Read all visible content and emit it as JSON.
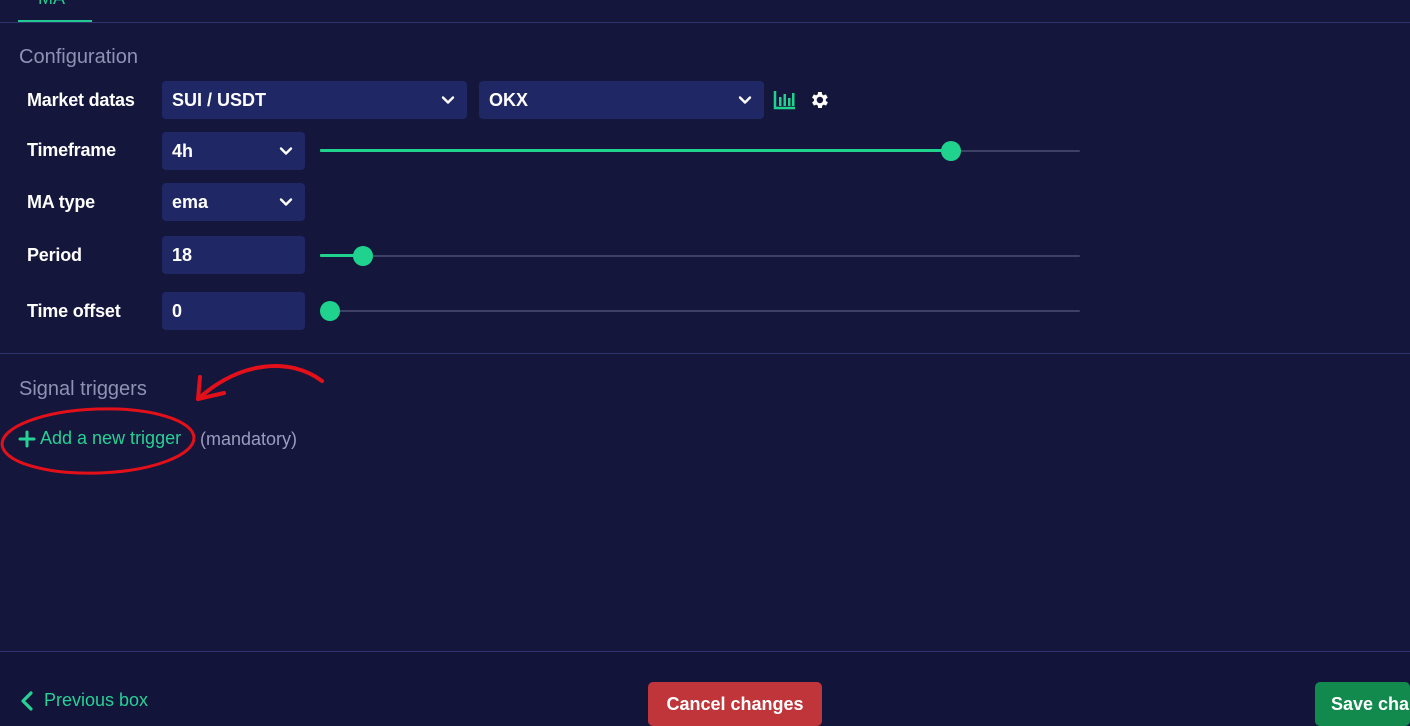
{
  "tab": {
    "label": "MA"
  },
  "configuration": {
    "title": "Configuration",
    "market": {
      "label": "Market datas",
      "pair": "SUI / USDT",
      "exchange": "OKX",
      "chart_icon": "chart-bars-icon",
      "settings_icon": "gear-icon"
    },
    "timeframe": {
      "label": "Timeframe",
      "value": "4h",
      "slider_fraction": 0.83
    },
    "ma_type": {
      "label": "MA type",
      "value": "ema"
    },
    "period": {
      "label": "Period",
      "value": "18",
      "slider_fraction": 0.056
    },
    "time_offset": {
      "label": "Time offset",
      "value": "0",
      "slider_fraction": 0.0
    }
  },
  "signal_triggers": {
    "title": "Signal triggers",
    "add_label": "Add a new trigger",
    "mandatory_note": "(mandatory)"
  },
  "footer": {
    "previous_label": "Previous box",
    "cancel_label": "Cancel changes",
    "save_label": "Save changes"
  },
  "colors": {
    "background": "#14163c",
    "accent": "#1fd38f",
    "field": "#1f2765",
    "cancel": "#c0353a",
    "save": "#128a4e",
    "annotation": "#e3101a"
  }
}
